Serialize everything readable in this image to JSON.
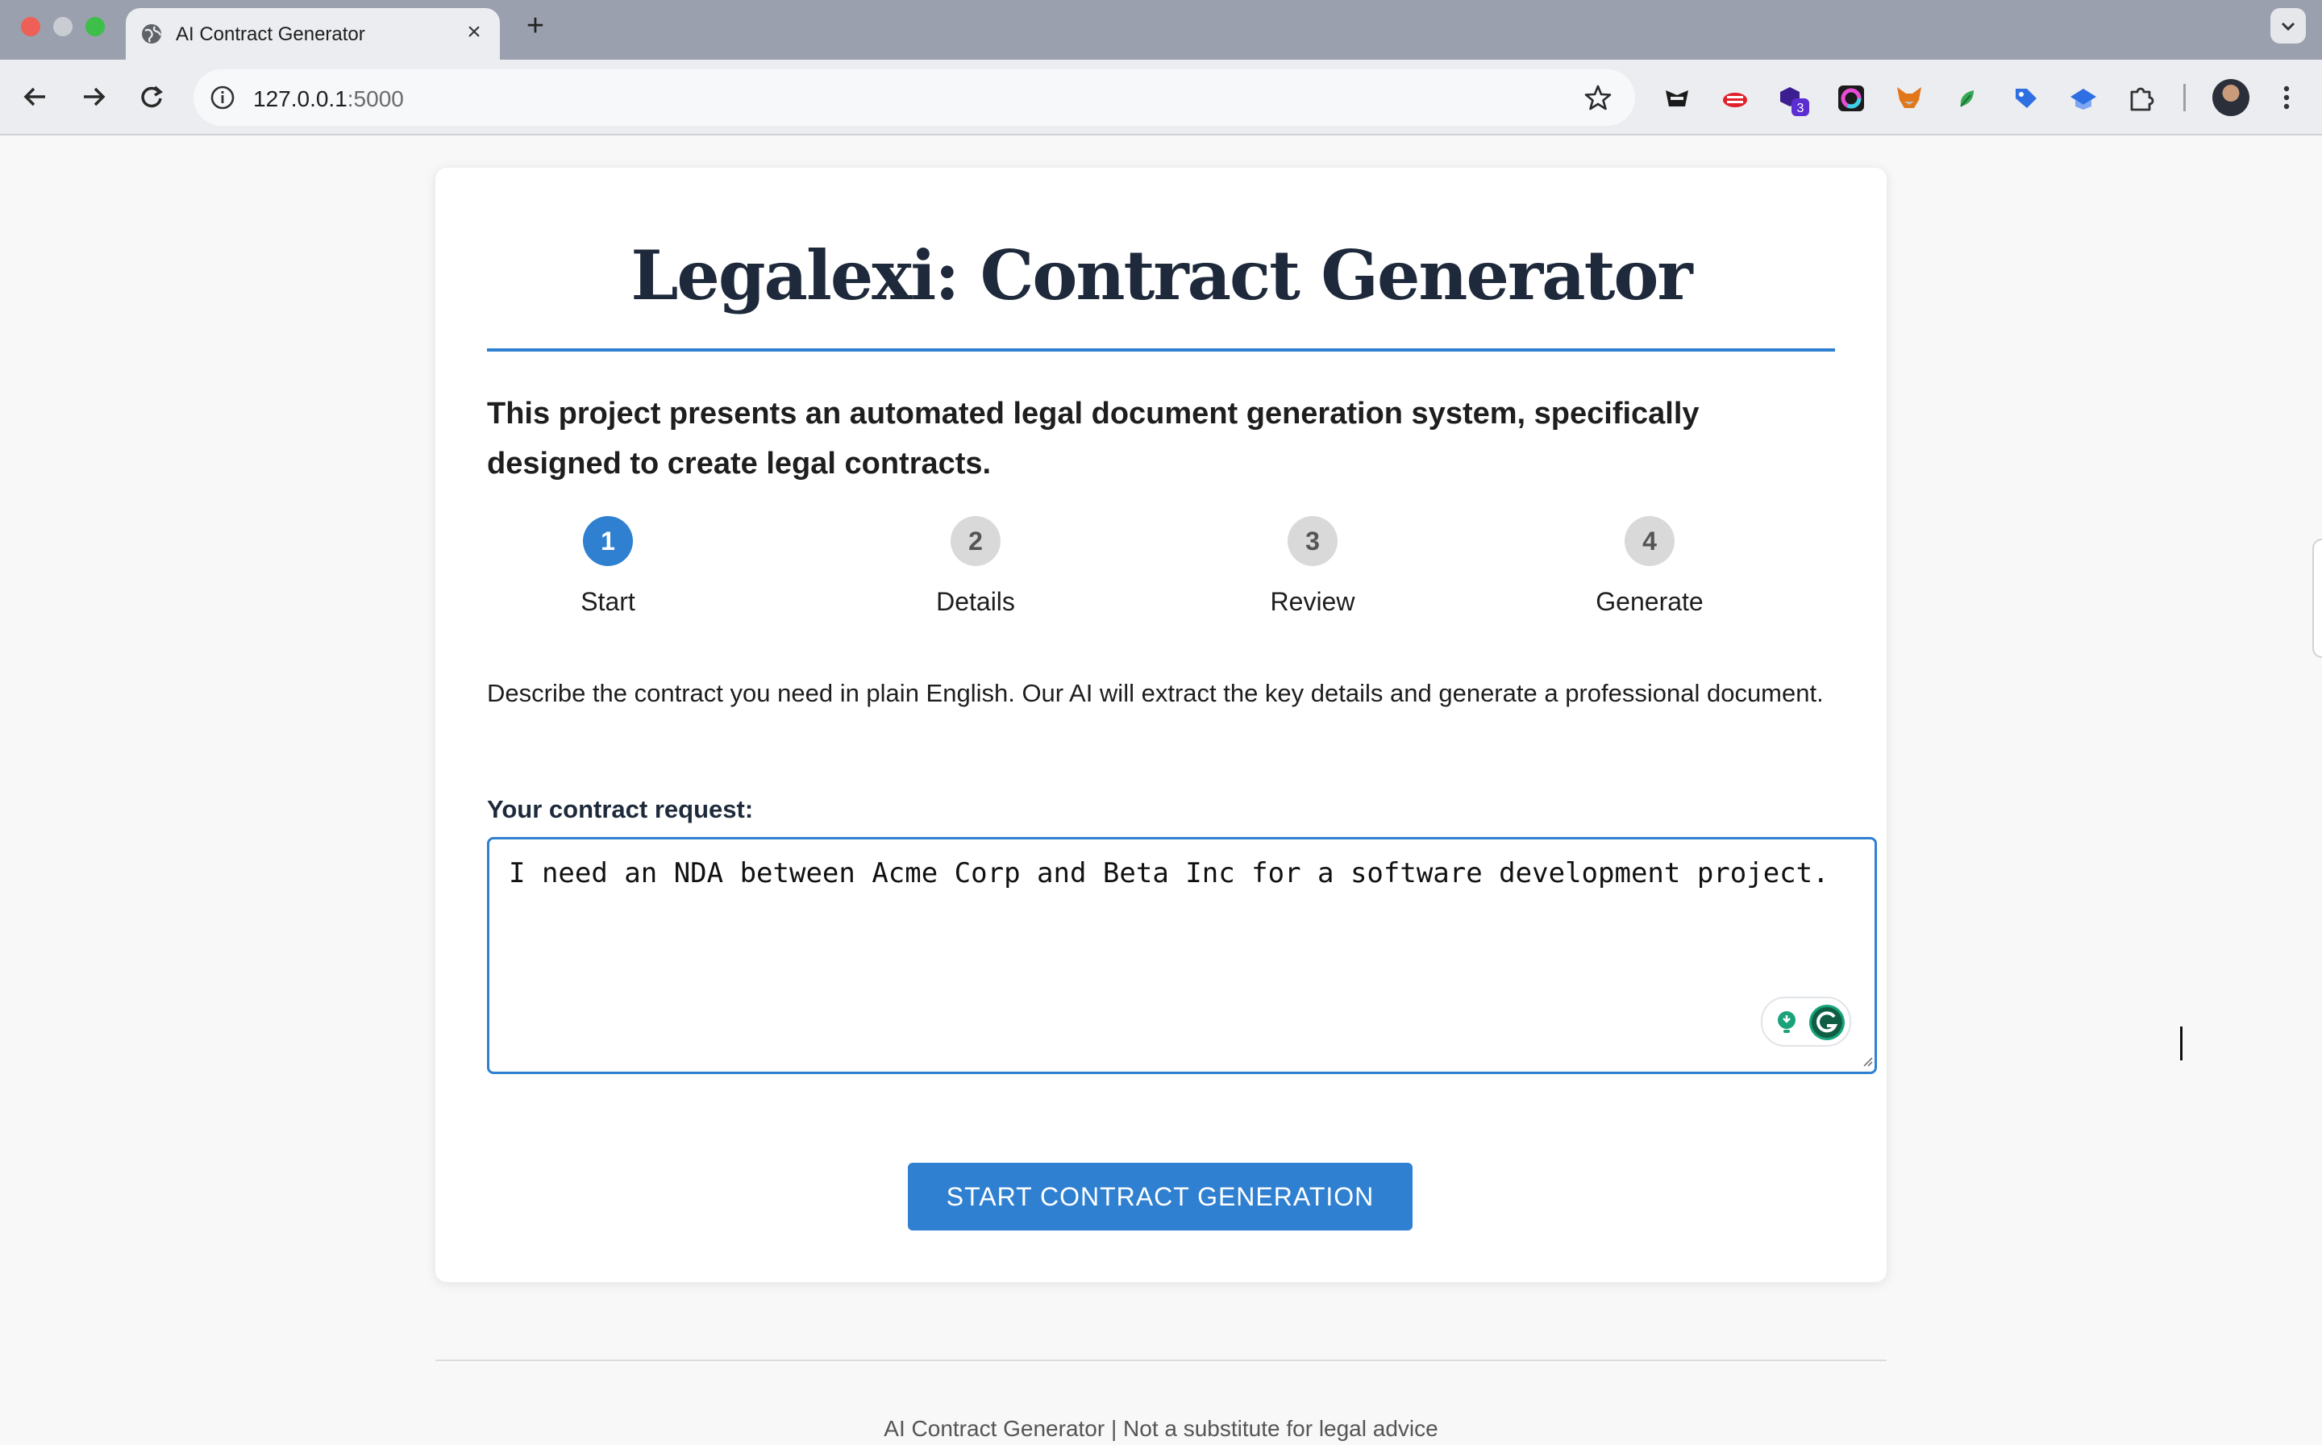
{
  "browser": {
    "tab_title": "AI Contract Generator",
    "tab_close": "×",
    "new_tab": "+",
    "url_host": "127.0.0.1",
    "url_port": ":5000",
    "extensions": [
      {
        "name": "ext-ninja-icon",
        "color": "#1b1b1b"
      },
      {
        "name": "ext-red-cloud-icon",
        "color": "#e0212b"
      },
      {
        "name": "ext-purple-hex-icon",
        "color": "#3b1e8f",
        "badge": "3"
      },
      {
        "name": "ext-color-ring-icon",
        "color": "#1b1b1b"
      },
      {
        "name": "ext-fox-icon",
        "color": "#e2761b"
      },
      {
        "name": "ext-green-leaf-icon",
        "color": "#35a853"
      },
      {
        "name": "ext-blue-tag-icon",
        "color": "#2f6fe4"
      },
      {
        "name": "ext-blue-cap-icon",
        "color": "#2f6fe4"
      },
      {
        "name": "extensions-puzzle-icon",
        "color": "#333333"
      }
    ]
  },
  "page": {
    "title": "Legalexi: Contract Generator",
    "intro": "This project presents an automated legal document generation system, specifically designed to create legal contracts.",
    "steps": [
      {
        "number": "1",
        "label": "Start",
        "active": true
      },
      {
        "number": "2",
        "label": "Details",
        "active": false
      },
      {
        "number": "3",
        "label": "Review",
        "active": false
      },
      {
        "number": "4",
        "label": "Generate",
        "active": false
      }
    ],
    "description": "Describe the contract you need in plain English. Our AI will extract the key details and generate a professional document.",
    "request_label": "Your contract request:",
    "request_value": "I need an NDA between Acme Corp and Beta Inc for a software development project.",
    "cta_label": "START CONTRACT GENERATION",
    "footer": "AI Contract Generator | Not a substitute for legal advice"
  },
  "colors": {
    "accent": "#2f80d1",
    "title": "#1e2a3b",
    "step_inactive": "#d9d9d9"
  }
}
